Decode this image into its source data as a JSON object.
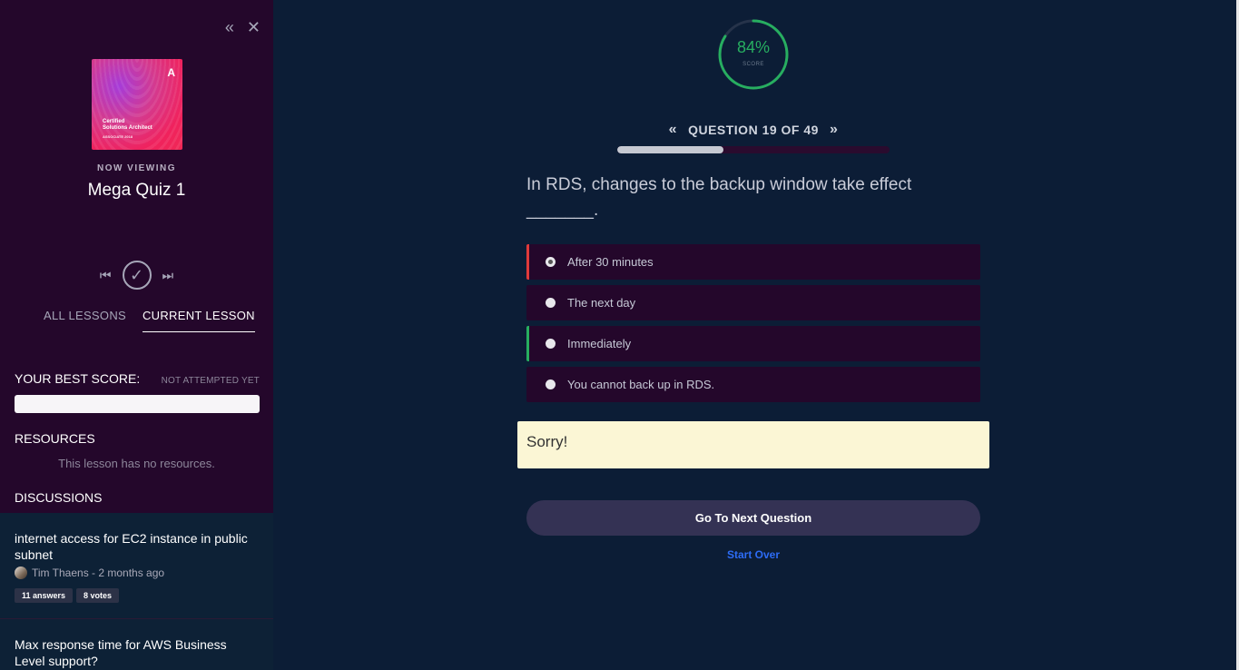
{
  "sidebar": {
    "collapse_icon": "«",
    "close_icon": "✕",
    "cover": {
      "logo": "A",
      "line1": "Certified",
      "line2": "Solutions Architect",
      "line3": "ASSOCIATE 2018"
    },
    "now_viewing": "NOW VIEWING",
    "lesson_title": "Mega Quiz 1",
    "tabs": [
      {
        "label": "ALL LESSONS"
      },
      {
        "label": "CURRENT LESSON"
      }
    ],
    "best_score_label": "YOUR BEST SCORE:",
    "best_score_status": "NOT ATTEMPTED YET",
    "resources_label": "RESOURCES",
    "no_resources": "This lesson has no resources.",
    "discussions_label": "DISCUSSIONS",
    "discussions": [
      {
        "title": "internet access for EC2 instance in public subnet",
        "meta": "Tim Thaens - 2 months ago",
        "answers": "11 answers",
        "votes": "8 votes"
      },
      {
        "title": "Max response time for AWS Business Level support?"
      }
    ]
  },
  "main": {
    "score": {
      "value_text": "84%",
      "label": "SCORE",
      "value": 84,
      "color": "#27ae60"
    },
    "question_nav": {
      "label": "QUESTION 19 OF 49",
      "current": 19,
      "total": 49
    },
    "progress_fraction": 0.39,
    "question": "In RDS, changes to the backup window take effect _______.",
    "answers": [
      {
        "label": "After 30 minutes",
        "state": "wrong",
        "selected": true
      },
      {
        "label": "The next day",
        "state": "none",
        "selected": false
      },
      {
        "label": "Immediately",
        "state": "correct",
        "selected": false
      },
      {
        "label": "You cannot back up in RDS.",
        "state": "none",
        "selected": false
      }
    ],
    "feedback": "Sorry!",
    "next_button": "Go To Next Question",
    "start_over": "Start Over"
  }
}
